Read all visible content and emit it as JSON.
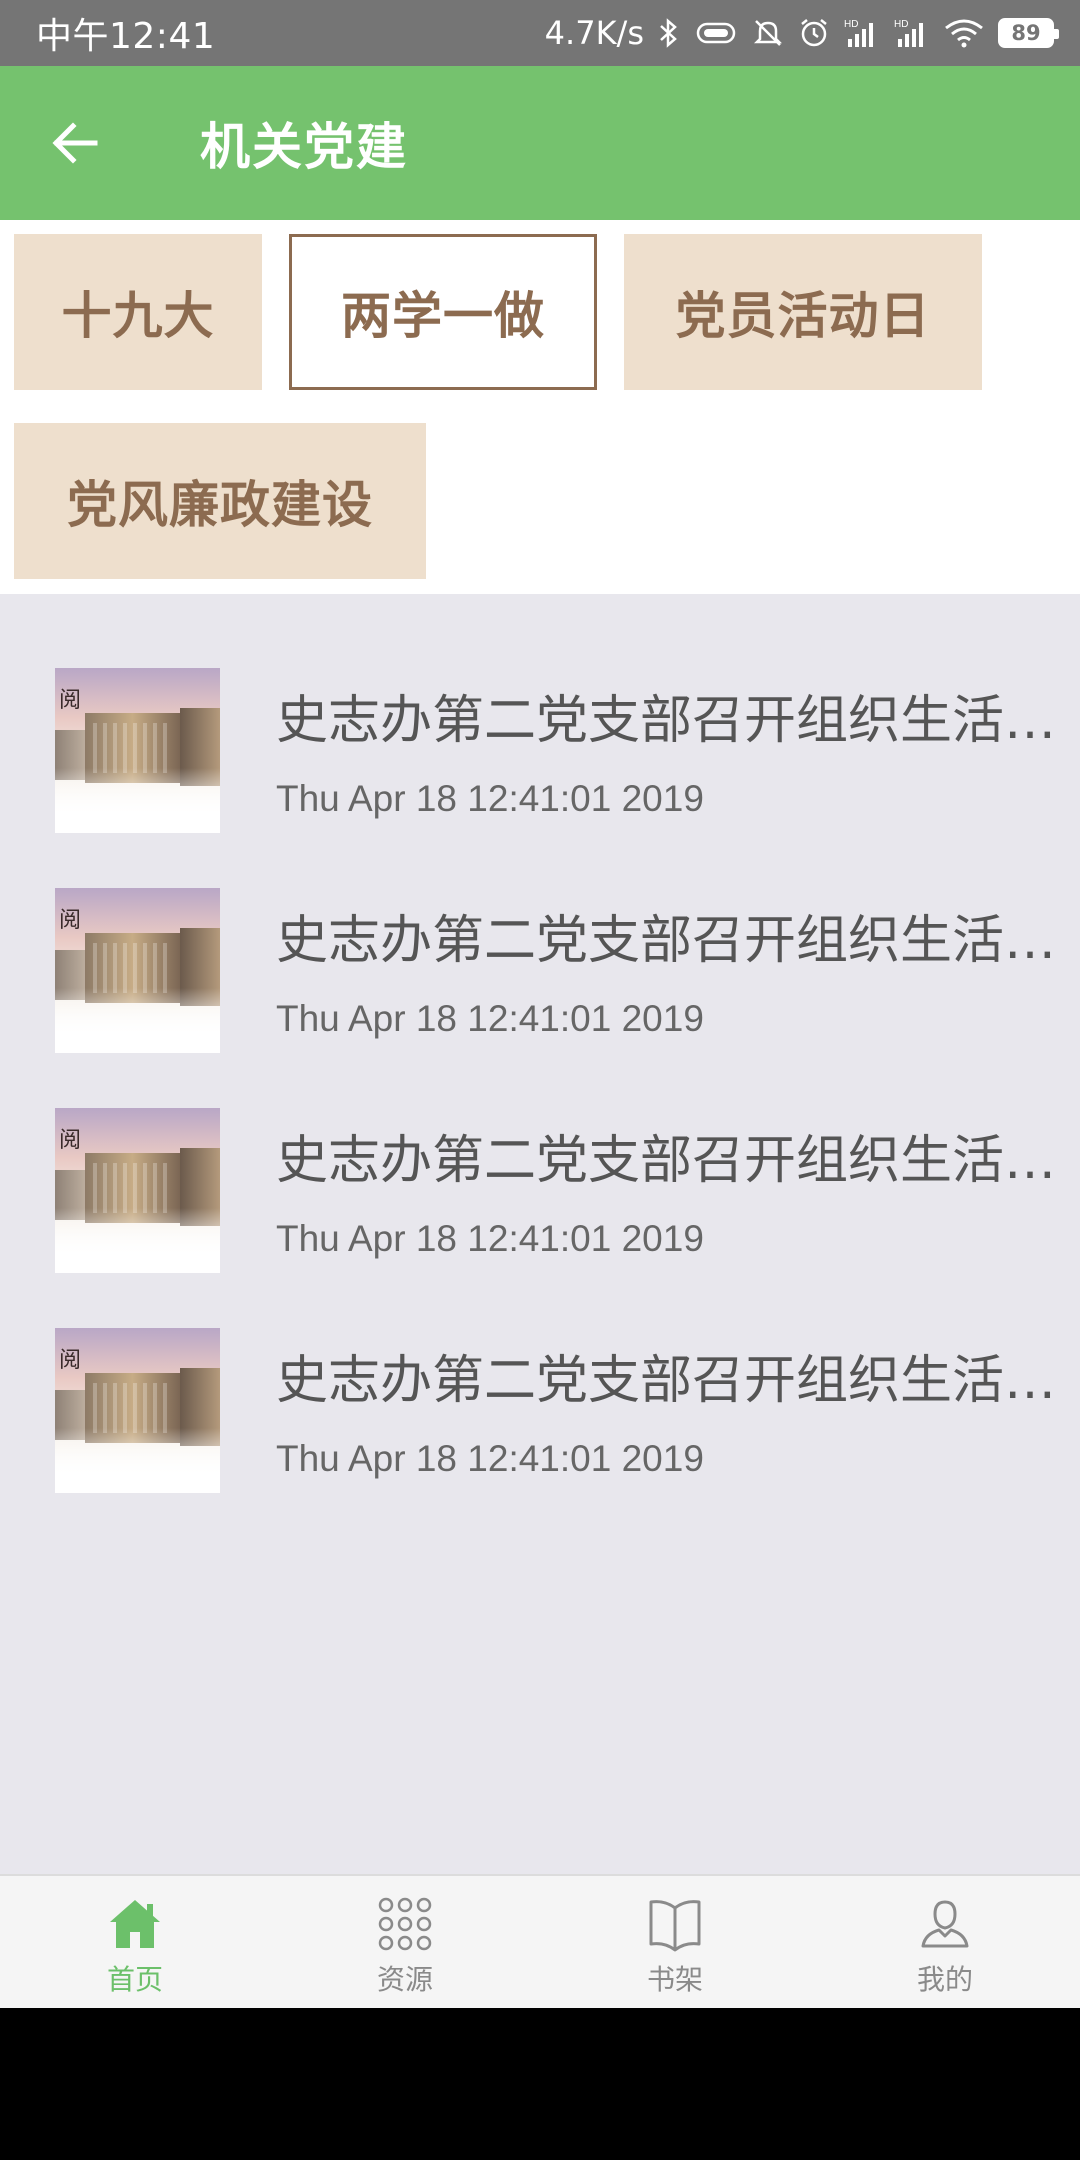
{
  "status_bar": {
    "time": "中午12:41",
    "net_speed": "4.7K/s",
    "battery": "89"
  },
  "app_bar": {
    "title": "机关党建"
  },
  "tags": [
    {
      "label": "十九大",
      "active": false
    },
    {
      "label": "两学一做",
      "active": true
    },
    {
      "label": "党员活动日",
      "active": false
    },
    {
      "label": "党风廉政建设",
      "active": false
    }
  ],
  "articles": [
    {
      "title": "史志办第二党支部召开组织生活…",
      "date": "Thu Apr 18 12:41:01 2019"
    },
    {
      "title": "史志办第二党支部召开组织生活…",
      "date": "Thu Apr 18 12:41:01 2019"
    },
    {
      "title": "史志办第二党支部召开组织生活…",
      "date": "Thu Apr 18 12:41:01 2019"
    },
    {
      "title": "史志办第二党支部召开组织生活…",
      "date": "Thu Apr 18 12:41:01 2019"
    }
  ],
  "bottom_nav": [
    {
      "label": "首页",
      "icon": "home-icon",
      "active": true
    },
    {
      "label": "资源",
      "icon": "grid-dots-icon",
      "active": false
    },
    {
      "label": "书架",
      "icon": "book-icon",
      "active": false
    },
    {
      "label": "我的",
      "icon": "person-icon",
      "active": false
    }
  ],
  "colors": {
    "app_bar": "#75c26e",
    "tag_bg": "#eedfcd",
    "tag_text": "#8c6b50",
    "list_bg": "#e8e7ed",
    "nav_active": "#6cc06a"
  }
}
